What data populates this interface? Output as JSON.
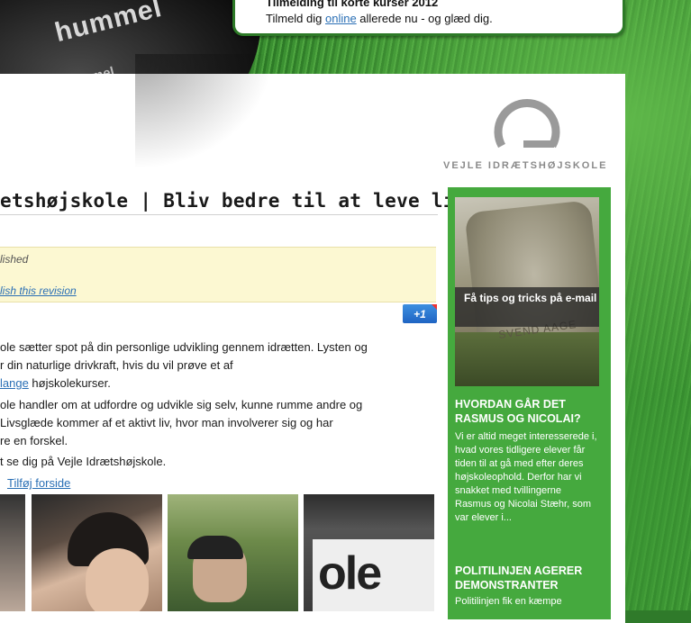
{
  "announcement": {
    "heading": "Tilmelding til korte kurser 2012",
    "prefix": "Tilmeld dig ",
    "link": "online",
    "suffix": " allerede nu - og glæd dig."
  },
  "shoe": {
    "brand": "hummel",
    "brand_small": "hummel"
  },
  "logo": {
    "text": "VEJLE IDRÆTSHØJSKOLE"
  },
  "page": {
    "title": "etshøjskole | Bliv bedre til at leve livet",
    "notice_line1": "lished",
    "notice_line2": "lish this revision",
    "plusone": "+1",
    "p1_a": "ole sætter spot på din personlige udvikling gennem idrætten. Lysten og",
    "p1_b": "r din naturlige drivkraft, hvis du vil prøve et af",
    "p1_c_link": "lange",
    "p1_c_rest": " højskolekurser.",
    "p2_a": "ole handler om at udfordre og udvikle sig selv, kunne rumme andre og",
    "p2_b": " Livsglæde kommer af et aktivt liv, hvor man involverer sig og har",
    "p2_c": "re en forskel.",
    "p3": "t se dig på Vejle Idrætshøjskole.",
    "add_front": "Tilføj forside",
    "photo_sign": "ole"
  },
  "sidebar": {
    "promo": "Få tips og tricks på e-mail",
    "engraving": "SVEND AAGE",
    "heading1": "Hvordan går det Rasmus og Nicolai?",
    "text1": "Vi er altid meget interesserede i, hvad vores tidligere elever får tiden til at gå med efter deres højskoleophold. Derfor har vi snakket med tvillingerne Rasmus og Nicolai Stæhr, som var elever i...",
    "heading2": "Politilinjen agerer demonstranter",
    "text2": "Politilinjen fik en kæmpe"
  },
  "colors": {
    "sidebar_green": "#45a93e",
    "link_blue": "#2a6fb5",
    "notice_yellow": "#fcf8d2"
  }
}
